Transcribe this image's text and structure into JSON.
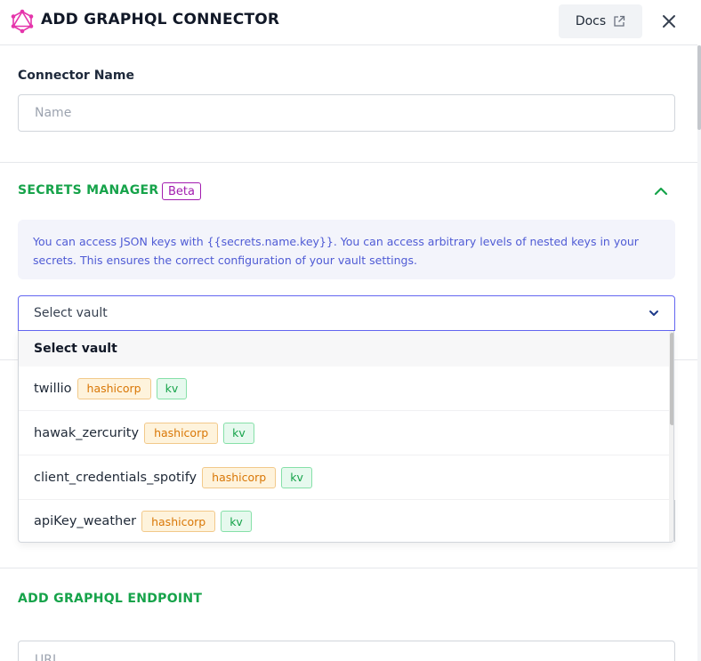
{
  "header": {
    "title": "ADD GRAPHQL CONNECTOR",
    "docs_label": "Docs"
  },
  "connector": {
    "label": "Connector Name",
    "placeholder": "Name",
    "value": ""
  },
  "secrets": {
    "title": "SECRETS MANAGER",
    "badge": "Beta",
    "info": "You can access JSON keys with {{secrets.name.key}}. You can access arbitrary levels of nested keys in your secrets. This ensures the correct configuration of your vault settings.",
    "select_value": "Select vault",
    "dropdown": {
      "header": "Select vault",
      "options": [
        {
          "name": "twillio",
          "type": "hashicorp",
          "engine": "kv"
        },
        {
          "name": "hawak_zercurity",
          "type": "hashicorp",
          "engine": "kv"
        },
        {
          "name": "client_credentials_spotify",
          "type": "hashicorp",
          "engine": "kv"
        },
        {
          "name": "apiKey_weather",
          "type": "hashicorp",
          "engine": "kv"
        }
      ]
    }
  },
  "endpoint": {
    "title": "ADD GRAPHQL ENDPOINT",
    "placeholder": "URL"
  },
  "colors": {
    "accent_green": "#16a34a",
    "brand_pink": "#e535ab",
    "beta_purple": "#a21caf",
    "info_text": "#4f5bd5",
    "select_border": "#6366f1"
  },
  "icons": {
    "logo": "graphql-logo-icon",
    "docs": "external-link-icon",
    "close": "close-icon",
    "collapse": "chevron-up-icon",
    "select": "chevron-down-icon"
  }
}
